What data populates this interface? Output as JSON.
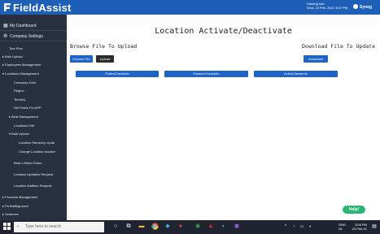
{
  "app": {
    "brand": "FieldAssist",
    "user_name": "Sanang hari",
    "datetime": "Wed, 24 Feb, 2021 3:07 PM",
    "org": "Syneg"
  },
  "sidebar": {
    "top_items": [
      {
        "label": "My Dashboard",
        "icon": "dashboard-icon"
      },
      {
        "label": "Company Settings",
        "icon": "gear-icon"
      }
    ],
    "items": [
      "Tour Plus",
      "▸  Bulk Upload",
      "▸  Employees Management",
      "▾  Locations Management",
      "Company Zone",
      "Region",
      "Territory",
      "Set Fields For APP",
      "▸  Beat Management",
      "Locations Edit",
      "▾  Bulk Upload",
      "Location Hierarchy Upda",
      "Change Location Isactive",
      "Beat o Meter Rules",
      "Location Updation Request",
      "Location Addition Request",
      "▸  Products Management",
      "▸  FA Battleground",
      "▸  Schemes"
    ]
  },
  "main": {
    "title": "Location Activate/Deactivate",
    "browse_title": "Browse File To Upload",
    "download_title": "Download File To Update",
    "choose_file": "Choose File",
    "upload": "Upload",
    "download": "Download",
    "prelim": "PrelimCheckInfo",
    "passive": "PassiveCheckInfo",
    "active": "ActiveCheckInfo"
  },
  "help": "Help!",
  "taskbar": {
    "search_placeholder": "Type here to search",
    "lang": "ENG",
    "lang2": "IN",
    "time": "3:09 PM",
    "date": "24-Feb-21"
  },
  "colors": {
    "brand_blue": "#1e5fb8",
    "button_blue": "#1e64c8",
    "sidebar": "#27313f",
    "help_green": "#2ab673"
  }
}
